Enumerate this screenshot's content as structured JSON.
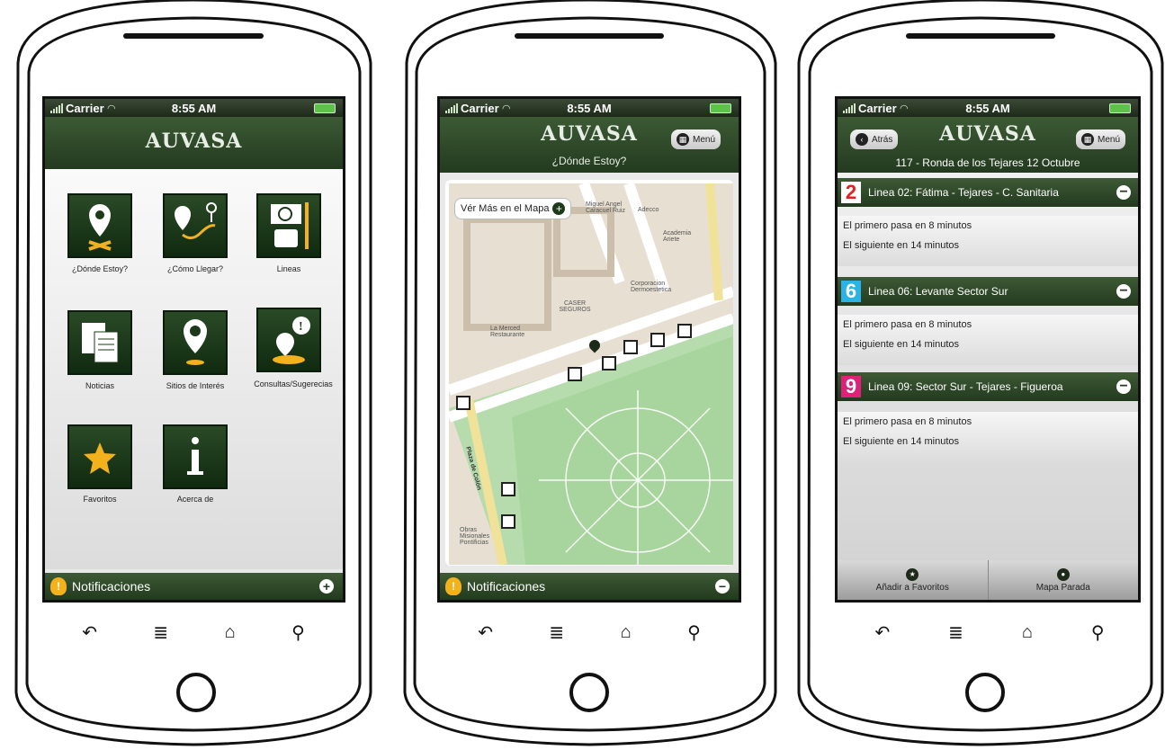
{
  "status": {
    "carrier": "Carrier",
    "time": "8:55 AM"
  },
  "brand": {
    "logo_text": "AUVASA"
  },
  "phone1": {
    "tiles": [
      {
        "label": "¿Dónde Estoy?",
        "icon": "map-pin-icon"
      },
      {
        "label": "¿Cómo Llegar?",
        "icon": "route-icon"
      },
      {
        "label": "Lineas",
        "icon": "bus-schedule-icon"
      },
      {
        "label": "Noticias",
        "icon": "newspaper-icon"
      },
      {
        "label": "Sitios de Interés",
        "icon": "landmark-pin-icon"
      },
      {
        "label": "Consultas/Sugerecias",
        "icon": "speech-pin-icon"
      },
      {
        "label": "Favoritos",
        "icon": "star-icon"
      },
      {
        "label": "Acerca de",
        "icon": "info-icon"
      }
    ],
    "notifications_label": "Notificaciones"
  },
  "phone2": {
    "menu_button": "Menú",
    "title": "¿Dónde Estoy?",
    "map_button": "Vér Más en el Mapa",
    "map_labels": [
      "Miguel Angel Caracuel Ruiz",
      "Adecco",
      "Academia Ariete",
      "CASER SEGUROS",
      "Corporacion Dermoestetica",
      "La Merced Restaurante",
      "Plaza de Colón",
      "Obras Misionales Pontificias"
    ],
    "notifications_label": "Notificaciones"
  },
  "phone3": {
    "back_button": "Atrás",
    "menu_button": "Menú",
    "stop_title": "117 - Ronda de los Tejares 12 Octubre",
    "lines": [
      {
        "number": "2",
        "name": "Linea 02: Fátima - Tejares - C. Sanitaria",
        "color": "#e0211f",
        "first": "El primero pasa en 8 minutos",
        "next": "El siguiente en 14 minutos"
      },
      {
        "number": "6",
        "name": "Linea 06: Levante Sector Sur",
        "color": "#2ab3e6",
        "first": "El primero pasa en 8 minutos",
        "next": "El siguiente en 14 minutos"
      },
      {
        "number": "9",
        "name": "Linea 09: Sector Sur - Tejares - Figueroa",
        "color": "#e0217a",
        "first": "El primero pasa en 8 minutos",
        "next": "El siguiente en 14 minutos"
      }
    ],
    "tabs": [
      {
        "label": "Añadir a Favoritos",
        "icon": "star-icon"
      },
      {
        "label": "Mapa Parada",
        "icon": "map-pin-icon"
      }
    ]
  },
  "nav_icons": [
    "back-icon",
    "menu-icon",
    "home-icon",
    "search-icon"
  ],
  "colors": {
    "header_green": "#2d4a28",
    "tile_green": "#1c3a1a",
    "accent_yellow": "#f3b11d"
  }
}
